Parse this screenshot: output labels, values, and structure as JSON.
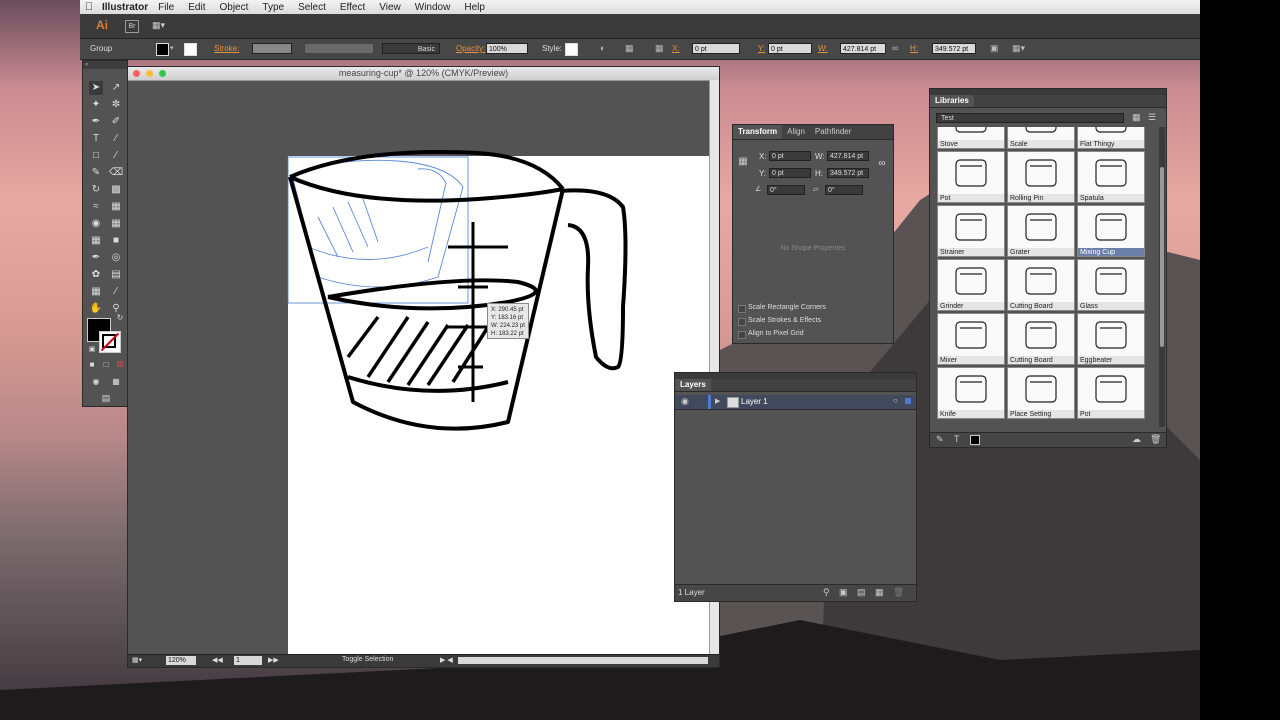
{
  "menubar": {
    "app_name": "Illustrator",
    "items": [
      "File",
      "Edit",
      "Object",
      "Type",
      "Select",
      "Effect",
      "View",
      "Window",
      "Help"
    ]
  },
  "appbar": {
    "logo": "Ai",
    "bridge": "Br"
  },
  "control_bar": {
    "selection_type": "Group",
    "stroke_label": "Stroke:",
    "brush_label": "Basic",
    "opacity_label": "Opacity:",
    "opacity_value": "100%",
    "style_label": "Style:",
    "x_label": "X:",
    "x_value": "0 pt",
    "y_label": "Y:",
    "y_value": "0 pt",
    "w_label": "W:",
    "w_value": "427.814 pt",
    "h_label": "H:",
    "h_value": "349.572 pt"
  },
  "document": {
    "title": "measuring-cup* @ 120% (CMYK/Preview)",
    "zoom": "120%",
    "page": "1",
    "status_mode": "Toggle Selection"
  },
  "tooltip": {
    "x": "X: 290.45 pt",
    "y": "Y: 183.16 pt",
    "w": "W: 224.23 pt",
    "h": "H: 183.22 pt"
  },
  "transform_panel": {
    "tabs": [
      "Transform",
      "Align",
      "Pathfinder"
    ],
    "x_label": "X:",
    "x_value": "0 pt",
    "y_label": "Y:",
    "y_value": "0 pt",
    "w_label": "W:",
    "w_value": "427.814 pt",
    "h_label": "H:",
    "h_value": "349.572 pt",
    "rotate_value": "0°",
    "shear_value": "0°",
    "no_shape": "No Shape Properties",
    "options": [
      "Scale Rectangle Corners",
      "Scale Strokes & Effects",
      "Align to Pixel Grid"
    ]
  },
  "layers_panel": {
    "title": "Layers",
    "layer_name": "Layer 1",
    "count": "1 Layer"
  },
  "libraries_panel": {
    "title": "Libraries",
    "library": "Test",
    "items": [
      {
        "label": "Stove"
      },
      {
        "label": "Scale"
      },
      {
        "label": "Flat Thingy"
      },
      {
        "label": "Pot"
      },
      {
        "label": "Rolling Pin"
      },
      {
        "label": "Spatula"
      },
      {
        "label": "Strainer"
      },
      {
        "label": "Grater"
      },
      {
        "label": "Mixing Cup"
      },
      {
        "label": "Grinder"
      },
      {
        "label": "Cutting Board"
      },
      {
        "label": "Glass"
      },
      {
        "label": "Mixer"
      },
      {
        "label": "Cutting Board"
      },
      {
        "label": "Eggbeater"
      },
      {
        "label": "Knife"
      },
      {
        "label": "Place Setting"
      },
      {
        "label": "Pot"
      }
    ],
    "selected_item": "Mixing Cup"
  },
  "colors": {
    "panel_bg": "#535353",
    "selection_blue": "#4a7bd0",
    "ai_orange": "#e37b2a"
  }
}
